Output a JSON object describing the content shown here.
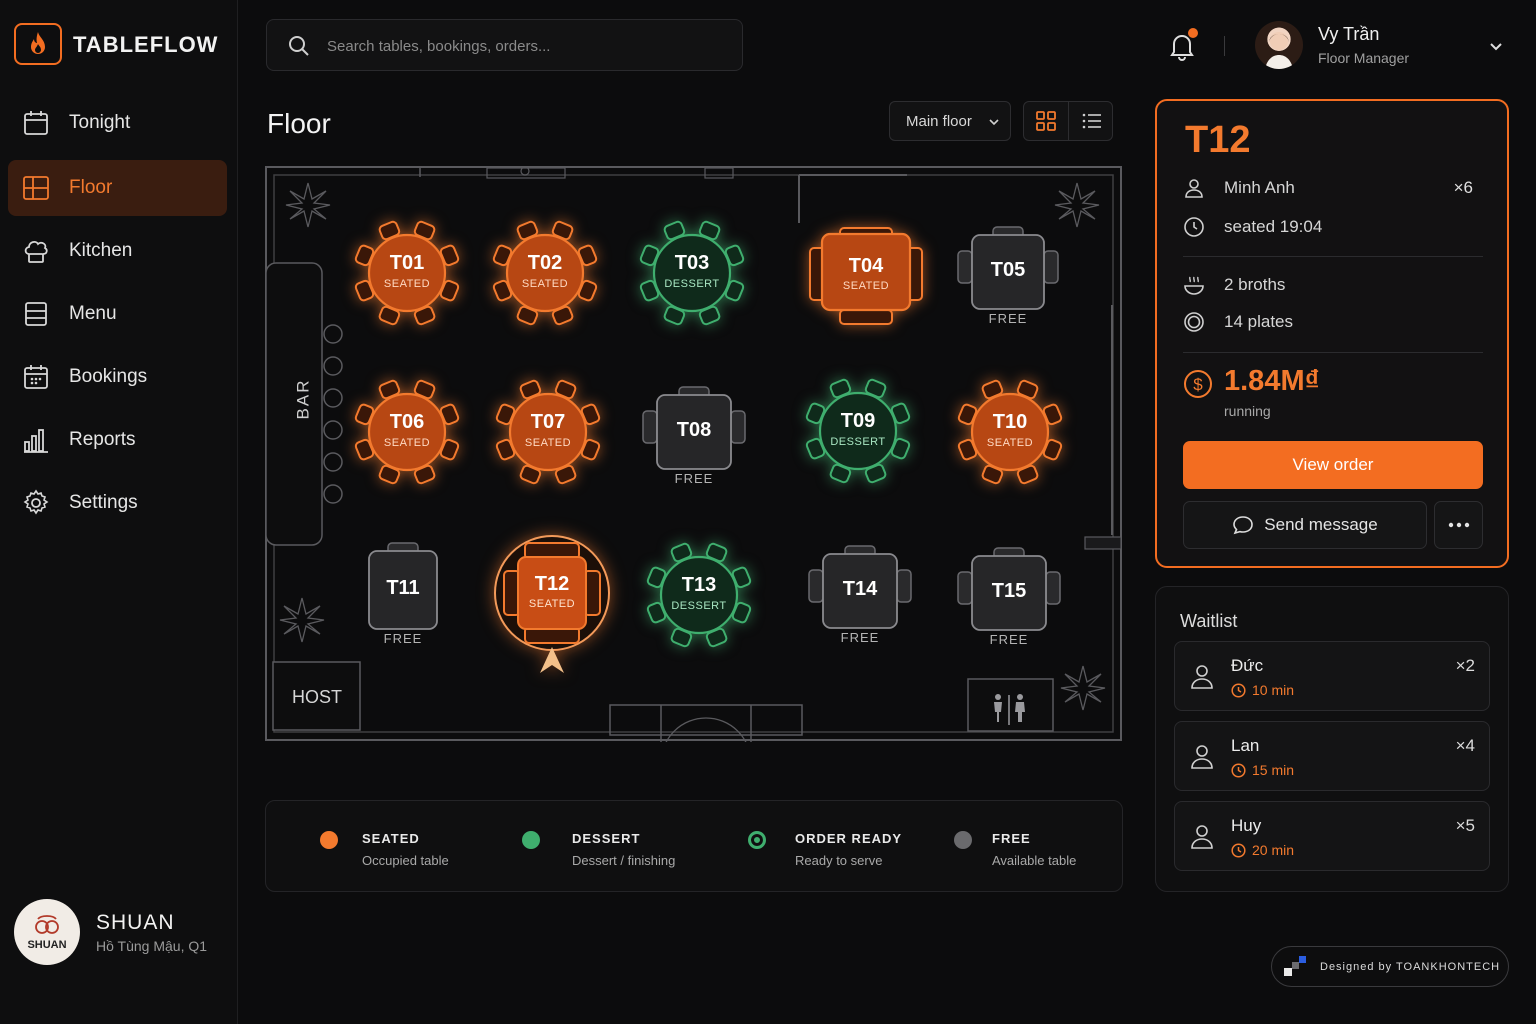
{
  "app": {
    "brand": "TABLEFLOW"
  },
  "sidebar": {
    "items": [
      {
        "label": "Tonight",
        "icon": "calendar-icon",
        "active": false
      },
      {
        "label": "Floor",
        "icon": "floor-grid-icon",
        "active": true
      },
      {
        "label": "Kitchen",
        "icon": "chef-hat-icon",
        "active": false
      },
      {
        "label": "Menu",
        "icon": "menu-icon",
        "active": false
      },
      {
        "label": "Bookings",
        "icon": "bookings-icon",
        "active": false
      },
      {
        "label": "Reports",
        "icon": "bar-chart-icon",
        "active": false
      },
      {
        "label": "Settings",
        "icon": "gear-icon",
        "active": false
      }
    ],
    "restaurant": {
      "logo_text": "SHUAN",
      "name": "SHUAN",
      "address": "Hồ Tùng Mậu, Q1"
    }
  },
  "search": {
    "placeholder": "Search tables, bookings, orders..."
  },
  "user": {
    "name": "Vy Trần",
    "role": "Floor Manager"
  },
  "floor": {
    "title": "Floor",
    "area_select": "Main floor",
    "labels": {
      "bar": "BAR",
      "host": "HOST"
    },
    "tables": [
      {
        "id": "T01",
        "status": "SEATED"
      },
      {
        "id": "T02",
        "status": "SEATED"
      },
      {
        "id": "T03",
        "status": "DESSERT"
      },
      {
        "id": "T04",
        "status": "SEATED"
      },
      {
        "id": "T05",
        "status": "FREE"
      },
      {
        "id": "T06",
        "status": "SEATED"
      },
      {
        "id": "T07",
        "status": "SEATED"
      },
      {
        "id": "T08",
        "status": "FREE"
      },
      {
        "id": "T09",
        "status": "DESSERT"
      },
      {
        "id": "T10",
        "status": "SEATED"
      },
      {
        "id": "T11",
        "status": "FREE"
      },
      {
        "id": "T12",
        "status": "SEATED",
        "selected": true
      },
      {
        "id": "T13",
        "status": "DESSERT"
      },
      {
        "id": "T14",
        "status": "FREE"
      },
      {
        "id": "T15",
        "status": "FREE"
      }
    ]
  },
  "legend": [
    {
      "title": "SEATED",
      "desc": "Occupied table",
      "color": "#f37a2e"
    },
    {
      "title": "DESSERT",
      "desc": "Dessert / finishing",
      "color": "#3fae6e"
    },
    {
      "title": "ORDER READY",
      "desc": "Ready to serve",
      "color": "#3fae6e"
    },
    {
      "title": "FREE",
      "desc": "Available table",
      "color": "#6a6a6d"
    }
  ],
  "detail": {
    "table": "T12",
    "guest": "Minh Anh",
    "party": "×6",
    "seated": "seated 19:04",
    "broths": "2 broths",
    "plates": "14 plates",
    "amount": "1.84M₫",
    "amount_label": "running",
    "view_order": "View order",
    "send_message": "Send message"
  },
  "waitlist": {
    "title": "Waitlist",
    "items": [
      {
        "name": "Đức",
        "party": "×2",
        "wait": "10 min"
      },
      {
        "name": "Lan",
        "party": "×4",
        "wait": "15 min"
      },
      {
        "name": "Huy",
        "party": "×5",
        "wait": "20 min"
      }
    ]
  },
  "credit": "Designed by TOANKHONTECH",
  "colors": {
    "accent": "#f36d21",
    "dessert": "#3fae6e",
    "free": "#3a3a3d"
  }
}
